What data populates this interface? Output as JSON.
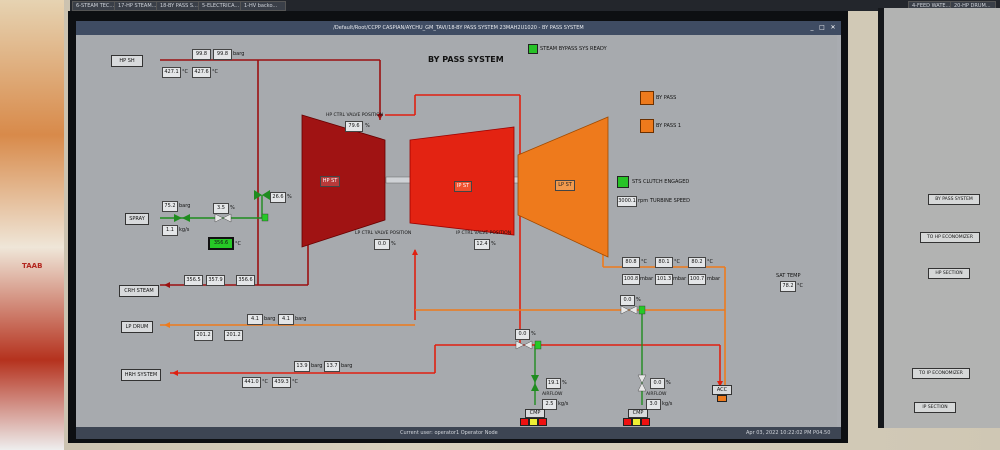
{
  "taskbar": {
    "tabs": [
      "6-STEAM TEC...",
      "17-HP STEAM...",
      "18-BY PASS S...",
      "5-ELECTRICA...",
      "1-HV backo..."
    ],
    "right_tabs": [
      "4-FEED WATE...",
      "20-HP DRUM..."
    ]
  },
  "window": {
    "title": "/Default/Root/CCPP CASPIAN/AYCHU_GM_TAVI/18-BY PASS SYSTEM 23MAH2U1020 - BY PASS SYSTEM",
    "controls": [
      "_",
      "□",
      "✕"
    ]
  },
  "diagram": {
    "title": "BY PASS SYSTEM",
    "steam_bypass_ready": "STEAM BYPASS SYS READY",
    "by_pass": "BY PASS",
    "by_pass_1": "BY PASS 1",
    "sts_clutch": "STS CLUTCH ENGAGED",
    "rpm_value": "3000.1",
    "rpm_label": "rpm",
    "turbine_speed": "TURBINE SPEED",
    "hp_st": "HP ST",
    "ip_st": "IP ST",
    "lp_st": "LP ST",
    "hp_sh_tag": "HP SH",
    "hp_press_1": "99.8",
    "hp_press_2": "99.8",
    "hp_press_unit": "barg",
    "hp_temp_1": "427.1",
    "hp_temp_2": "427.6",
    "temp_unit": "°C",
    "hp_ctrl_label": "HP CTRL VALVE POSITION",
    "hp_ctrl_value": "79.6",
    "hp_ctrl_unit": "%",
    "hp_bypass_valve": "26.6",
    "pct": "%",
    "spray_tag": "SPRAY",
    "spray_press": "75.2",
    "spray_press_unit": "barg",
    "spray_flow": "1.1",
    "spray_flow_unit": "kg/s",
    "spray_valve": "3.5",
    "spray_valve_unit": "%",
    "cold_temp": "356.6",
    "cold_temp_unit": "°C",
    "crh_1": "356.5",
    "crh_2": "357.9",
    "crh_3": "356.6",
    "crh_tag": "CRH STEAM",
    "lp_ctrl_label": "LP CTRL VALVE POSITION",
    "lp_ctrl_value": "0.0",
    "ip_ctrl_label": "IP CTRL VALVE POSITION",
    "ip_ctrl_value": "12.4",
    "lp_drum_tag": "LP DRUM",
    "lp_drum_p1": "4.1",
    "lp_drum_p2": "4.1",
    "lp_drum_t1": "201.2",
    "lp_drum_t2": "201.2",
    "hrh_tag": "HRH SYSTEM",
    "hrh_p1": "13.9",
    "hrh_p2": "13.7",
    "hrh_t1": "441.0",
    "hrh_t2": "439.3",
    "cond_t1": "80.8",
    "cond_t2": "80.1",
    "cond_t3": "80.2",
    "cond_p1": "100.8",
    "cond_p2": "101.3",
    "cond_p3": "100.7",
    "mbar": "mbar",
    "sat_temp_label": "SAT TEMP",
    "sat_temp": "78.2",
    "lp_bypass_valve": "0.0",
    "ip_bypass_valve": "0.0",
    "ip_spray_valve": "19.1",
    "ip_flow_label": "AIRFLOW",
    "ip_flow": "2.5",
    "lp_spray_valve": "0.0",
    "lp_flow_label": "AIRFLOW",
    "lp_flow": "3.0",
    "flow_unit": "kg/s",
    "cmp_1": "CMP",
    "cmp_2": "CMP",
    "acc_tag": "ACC"
  },
  "statusbar": {
    "left": "Current user: operator1   Operator Node",
    "right": "Apr 03, 2022 10:22:02 PM  P04.50"
  },
  "right_panel": {
    "bypass": "BY PASS SYSTEM",
    "hp_econ": "TO HP ECONOMIZER",
    "hp_section": "HP SECTION",
    "ip_econ": "TO IP ECONOMIZER",
    "ip_section": "IP SECTION"
  },
  "logo_text": "TAAB"
}
